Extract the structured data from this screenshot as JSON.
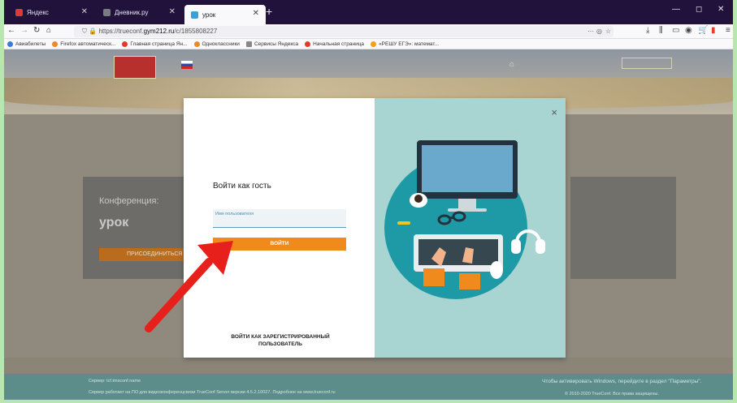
{
  "browser": {
    "tabs": [
      {
        "label": "Яндекс",
        "fav_color": "#e03a2c"
      },
      {
        "label": "Дневник.ру",
        "fav_color": "#7c7c7c"
      },
      {
        "label": "урок",
        "fav_color": "#3aa0d8"
      }
    ],
    "new_tab": "+",
    "window_controls": [
      "—",
      "◻",
      "✕"
    ],
    "url_prefix": "https://trueconf.",
    "url_host": "gym212.ru",
    "url_suffix": "/c/1855808227",
    "bookmarks": [
      {
        "label": "Авиабилеты",
        "color": "#3a7ad8"
      },
      {
        "label": "Firefox автоматическ...",
        "color": "#e88a2c"
      },
      {
        "label": "Главная страница Ян...",
        "color": "#e03a2c"
      },
      {
        "label": "Одноклассники",
        "color": "#e88a2c"
      },
      {
        "label": "Сервисы Яндекса",
        "color": "#888"
      },
      {
        "label": "Начальная страница",
        "color": "#e03a2c"
      },
      {
        "label": "«РЕШУ ЕГЭ»: математ...",
        "color": "#f0a01c"
      }
    ]
  },
  "page": {
    "conference_label": "Конференция:",
    "conference_name": "урок",
    "join_button": "ПРИСОЕДИНИТЬСЯ",
    "footer_line1": "Сервер: tcf.tmsconf.name",
    "footer_line2": "Сервер работает на ПО для видеоконференцсвязи TrueConf Server версии 4.5.2.10027. Подробнее на www.trueconf.ru",
    "footer_right1": "Чтобы активировать Windows, перейдите в раздел \"Параметры\".",
    "footer_right2": "© 2010-2020 TrueConf. Все права защищены."
  },
  "modal": {
    "title": "Войти как гость",
    "username_label": "Имя пользователя",
    "login_button": "ВОЙТИ",
    "register_link": "ВОЙТИ КАК ЗАРЕГИСТРИРОВАННЫЙ ПОЛЬЗОВАТЕЛЬ",
    "close": "×"
  },
  "colors": {
    "accent": "#f08a1c",
    "illustration_bg": "#a8d4d2",
    "circle": "#1e9aa6",
    "arrow": "#e8201c"
  }
}
